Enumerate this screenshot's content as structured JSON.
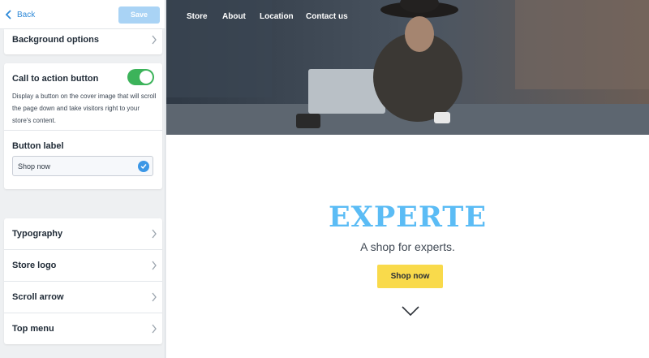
{
  "panel": {
    "back_label": "Back",
    "save_label": "Save",
    "background_options": "Background options",
    "cta": {
      "title": "Call to action button",
      "enabled": true,
      "description": "Display a button on the cover image that will scroll the page down and take visitors right to your store's content.",
      "button_label_heading": "Button label",
      "button_label_value": "Shop now"
    },
    "items": [
      {
        "label": "Typography"
      },
      {
        "label": "Store logo"
      },
      {
        "label": "Scroll arrow"
      },
      {
        "label": "Top menu"
      }
    ]
  },
  "preview": {
    "nav": [
      "Store",
      "About",
      "Location",
      "Contact us"
    ],
    "brand": "EXPERTE",
    "tagline": "A shop for experts.",
    "cta_label": "Shop now"
  },
  "colors": {
    "accent": "#2f8ad8",
    "save_disabled": "#a9d3f5",
    "toggle_on": "#3cb35a",
    "brand": "#5bbcf5",
    "cta_button": "#f9da4b"
  }
}
